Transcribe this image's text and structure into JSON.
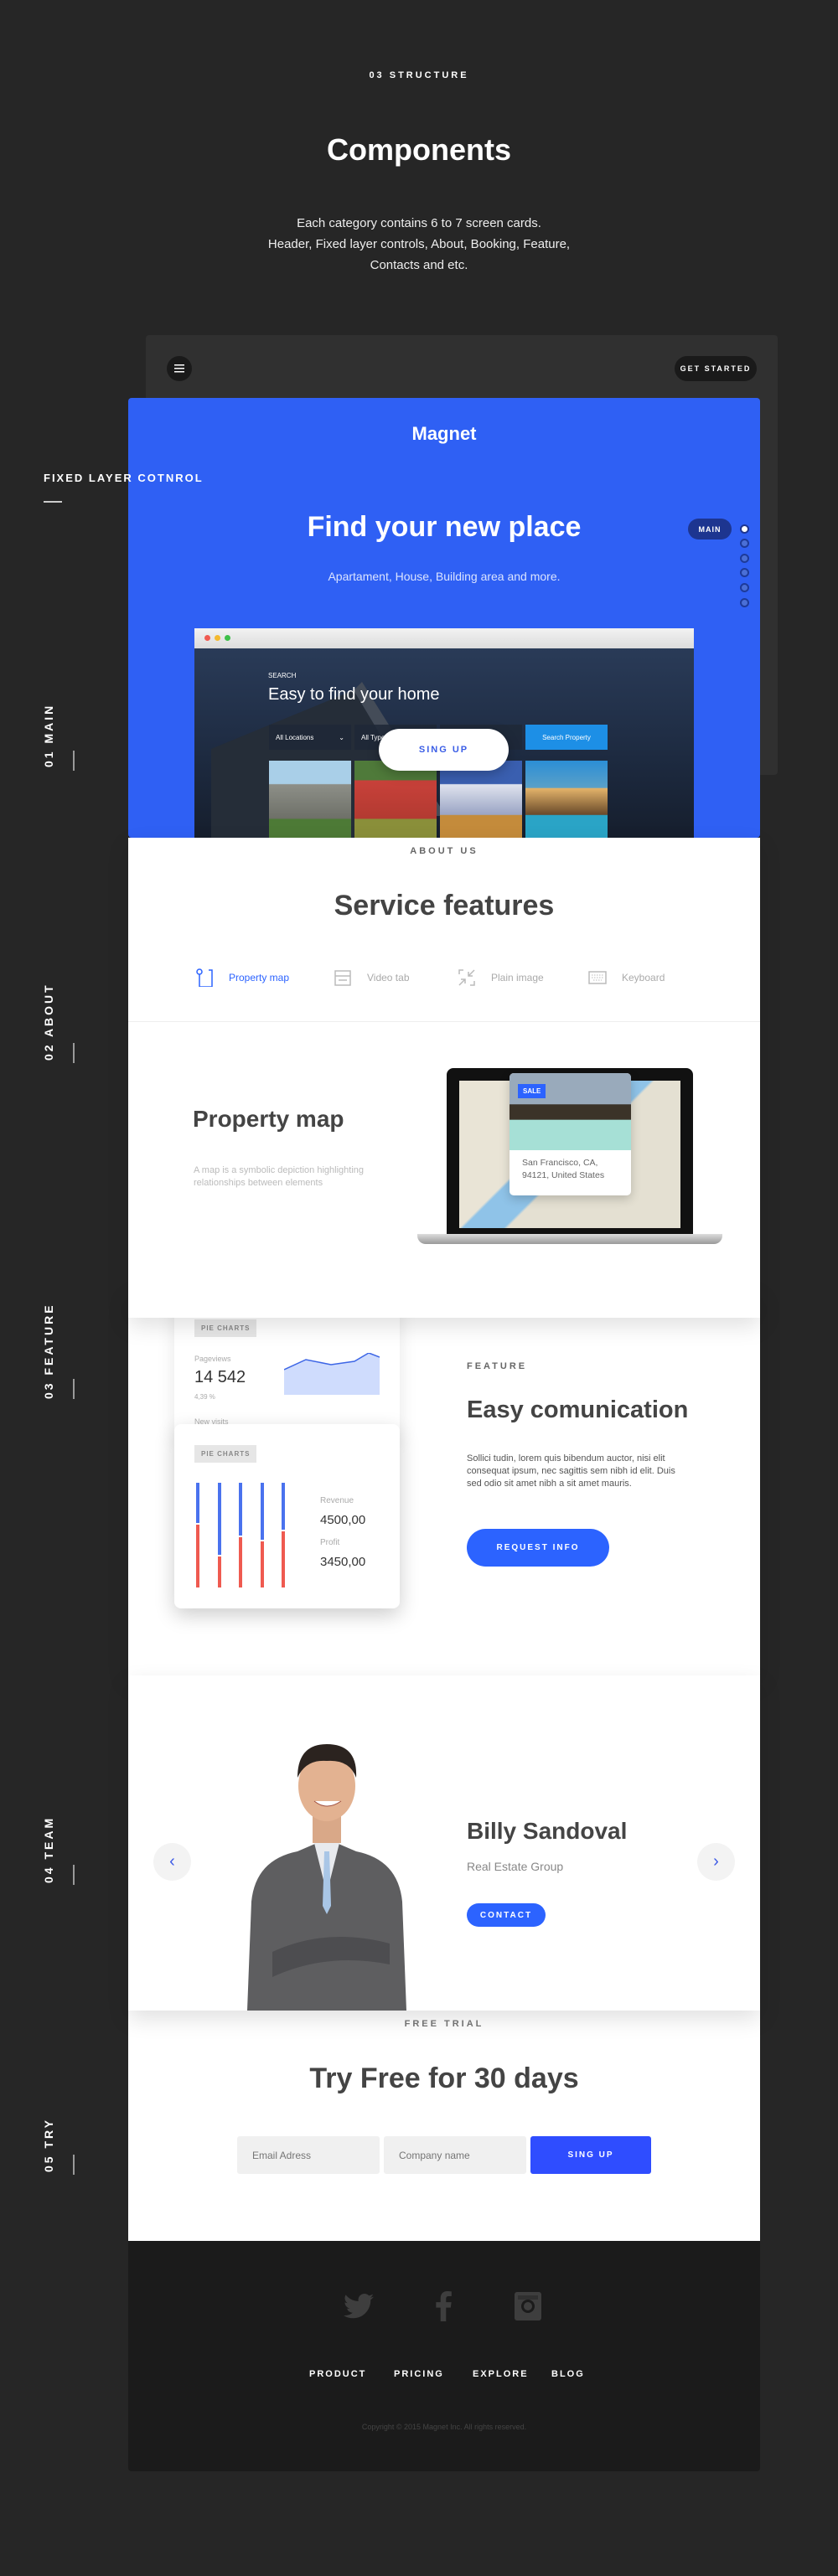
{
  "header": {
    "eyebrow": "03 STRUCTURE",
    "title": "Components",
    "desc": [
      "Each category contains 6 to 7 screen cards.",
      "Header, Fixed layer controls, About, Booking, Feature,",
      "Contacts and etc."
    ]
  },
  "side_labels": {
    "fixed": "FIXED LAYER COTNROL",
    "main": "01 MAIN",
    "about": "02 ABOUT",
    "feature": "03 FEATURE",
    "team": "04 TEAM",
    "try": "05 TRY"
  },
  "topbar": {
    "menu_icon": "hamburger-icon",
    "get_started": "GET STARTED"
  },
  "hero": {
    "logo": "Magnet",
    "title": "Find your new place",
    "subtitle": "Apartament, House, Building area and more.",
    "nav_active": "MAIN",
    "nav_dots": 6,
    "accent": "#2f62fb",
    "browser": {
      "search_label": "SEARCH",
      "search_title": "Easy to find your home",
      "location": "All Locations",
      "type": "All Types",
      "search_button": "Search Property",
      "signup": "SING UP"
    }
  },
  "about": {
    "eyebrow": "ABOUT US",
    "title": "Service features",
    "tabs": [
      {
        "label": "Property map",
        "icon": "map-pin-icon",
        "active": true
      },
      {
        "label": "Video tab",
        "icon": "video-tab-icon"
      },
      {
        "label": "Plain image",
        "icon": "collapse-icon"
      },
      {
        "label": "Keyboard",
        "icon": "keyboard-icon"
      }
    ],
    "feature_title": "Property map",
    "feature_desc": [
      "A map is a symbolic depiction highlighting",
      "relationships between elements"
    ],
    "card": {
      "badge": "SALE",
      "address": [
        "San Francisco, CA,",
        "94121, United States"
      ]
    }
  },
  "feature": {
    "card_label": "PIE CHARTS",
    "pageviews_label": "Pageviews",
    "pageviews": "14 542",
    "change": "4,39 %",
    "new_visits": "New visits",
    "revenue_label": "Revenue",
    "revenue": "4500,00",
    "profit_label": "Profit",
    "profit": "3450,00",
    "bars_blue_fraction": [
      0.38,
      0.69,
      0.5,
      0.54,
      0.45
    ],
    "eyebrow": "FEATURE",
    "title": "Easy comunication",
    "text": [
      "Sollici tudin, lorem quis bibendum auctor, nisi elit",
      "consequat ipsum, nec sagittis sem nibh id elit. Duis",
      "sed odio sit amet nibh a sit amet mauris."
    ],
    "button": "REQUEST INFO"
  },
  "team": {
    "name": "Billy Sandoval",
    "company": "Real Estate Group",
    "button": "CONTACT"
  },
  "trial": {
    "eyebrow": "FREE TRIAL",
    "title": "Try Free for 30 days",
    "email_placeholder": "Email Adress",
    "company_placeholder": "Company name",
    "button": "SING UP"
  },
  "footer": {
    "social": [
      "twitter-icon",
      "facebook-icon",
      "instagram-icon"
    ],
    "links": [
      "PRODUCT",
      "PRICING",
      "EXPLORE",
      "BLOG"
    ],
    "copyright": "Copyright © 2015 Magnet Inc. All rights reserved."
  }
}
